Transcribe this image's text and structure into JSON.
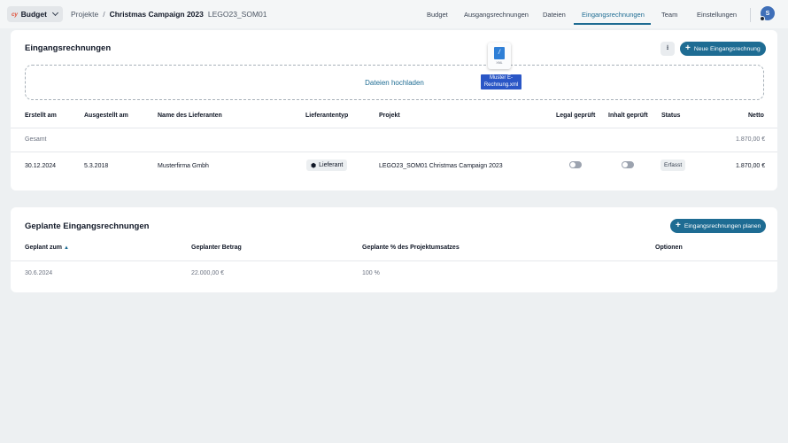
{
  "app": {
    "logo": "cy",
    "name": "Budget"
  },
  "breadcrumb": {
    "projects": "Projekte",
    "separator": "/",
    "current": "Christmas Campaign 2023",
    "code": "LEGO23_SOM01"
  },
  "nav": {
    "tabs": [
      "Budget",
      "Ausgangsrechnungen",
      "Dateien",
      "Eingangsrechnungen",
      "Team",
      "Einstellungen"
    ],
    "active": "Eingangsrechnungen"
  },
  "user": {
    "initial": "S"
  },
  "invoices": {
    "title": "Eingangsrechnungen",
    "new_button": "Neue Eingangsrechnung",
    "dropzone_label": "Dateien hochladen",
    "drag_file": {
      "name": "Muster E-Rechnung.xml",
      "ext": "XML"
    },
    "columns": [
      "Erstellt am",
      "Ausgestellt am",
      "Name des Lieferanten",
      "Lieferantentyp",
      "Projekt",
      "Legal geprüft",
      "Inhalt geprüft",
      "Status",
      "Netto"
    ],
    "total_label": "Gesamt",
    "total_value": "1.870,00 €",
    "rows": [
      {
        "created": "30.12.2024",
        "issued": "5.3.2018",
        "supplier": "Musterfirma Gmbh",
        "supplier_type": "Lieferant",
        "project": "LEGO23_SOM01 Christmas Campaign 2023",
        "legal_checked": false,
        "content_checked": false,
        "status": "Erfasst",
        "net": "1.870,00 €"
      }
    ]
  },
  "planned": {
    "title": "Geplante Eingangsrechnungen",
    "plan_button": "Eingangsrechnungen planen",
    "columns": [
      "Geplant zum",
      "Geplanter Betrag",
      "Geplante % des Projektumsatzes",
      "Optionen"
    ],
    "rows": [
      {
        "date": "30.6.2024",
        "amount": "22.000,00 €",
        "percent": "100 %"
      }
    ]
  },
  "colors": {
    "accent": "#1e6c93",
    "background": "#edf0f2",
    "brand_logo": "#e0533b"
  }
}
